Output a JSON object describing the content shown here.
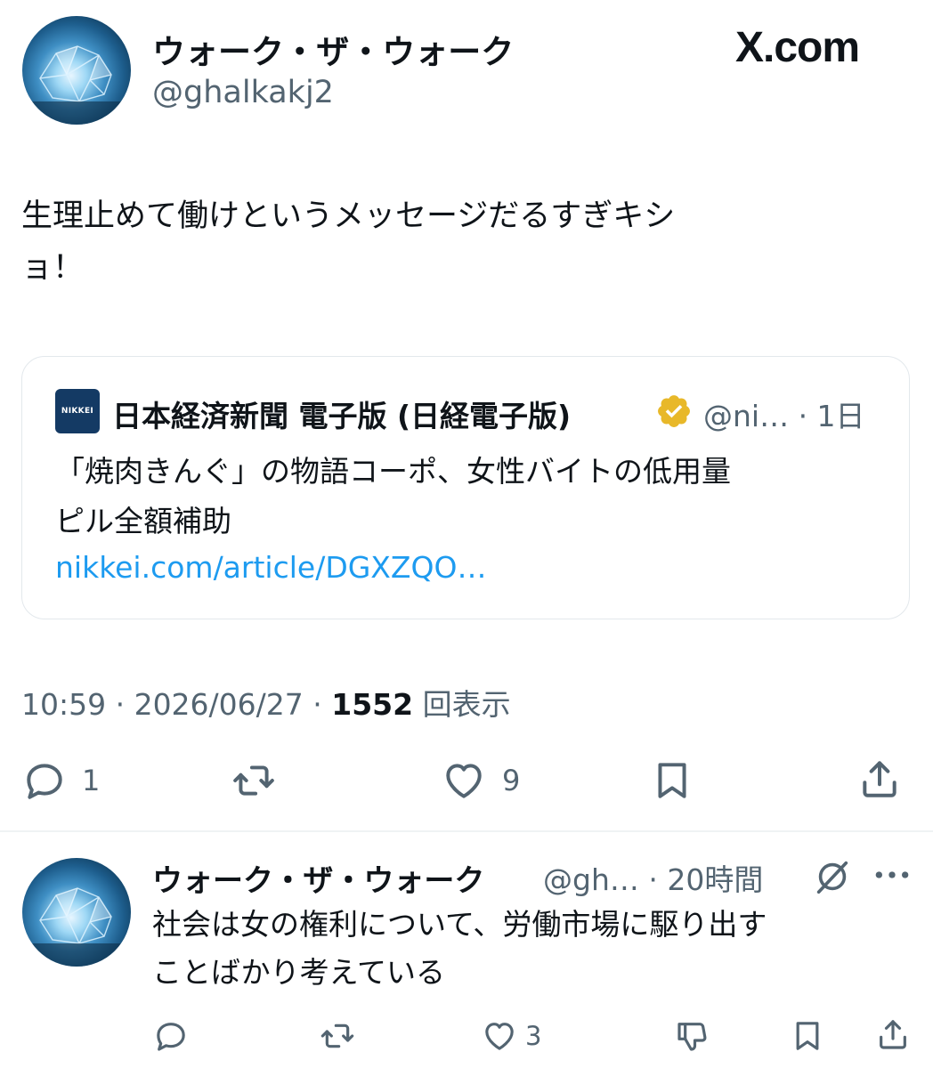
{
  "tweet": {
    "author_name": "ウォーク・ザ・ウォーク",
    "author_handle": "@ghalkakj2",
    "brand": "X.com",
    "text_line1": "生理止めて働けというメッセージだるすぎキシ",
    "text_line2": "ョ！",
    "quote": {
      "logo_text": "NIKKEI",
      "name": "日本経済新聞 電子版 (日経電子版)",
      "handle_time": "@ni… · 1日",
      "text_line1": "「焼肉きんぐ」の物語コーポ、女性バイトの低用量",
      "text_line2": "ピル全額補助",
      "link": "nikkei.com/article/DGXZQO…"
    },
    "meta_time": "10:59 · 2026/06/27 · ",
    "views_count": "1552",
    "views_label": " 回表示",
    "actions": {
      "reply_count": "1",
      "retweet_count": "",
      "like_count": "9"
    }
  },
  "reply": {
    "author_name": "ウォーク・ザ・ウォーク",
    "handle_time": "@gh… · 20時間",
    "text_line1": "社会は女の権利について、労働市場に駆り出す",
    "text_line2": "ことばかり考えている",
    "actions": {
      "like_count": "3"
    }
  },
  "colors": {
    "secondary": "#536471",
    "link": "#1d9bf0",
    "verified_gold": "#e8b829",
    "nikkei_navy": "#143a64"
  },
  "icons": [
    "reply-icon",
    "retweet-icon",
    "like-icon",
    "bookmark-icon",
    "share-icon",
    "verified-badge-icon",
    "grok-icon",
    "more-icon",
    "dislike-icon"
  ]
}
